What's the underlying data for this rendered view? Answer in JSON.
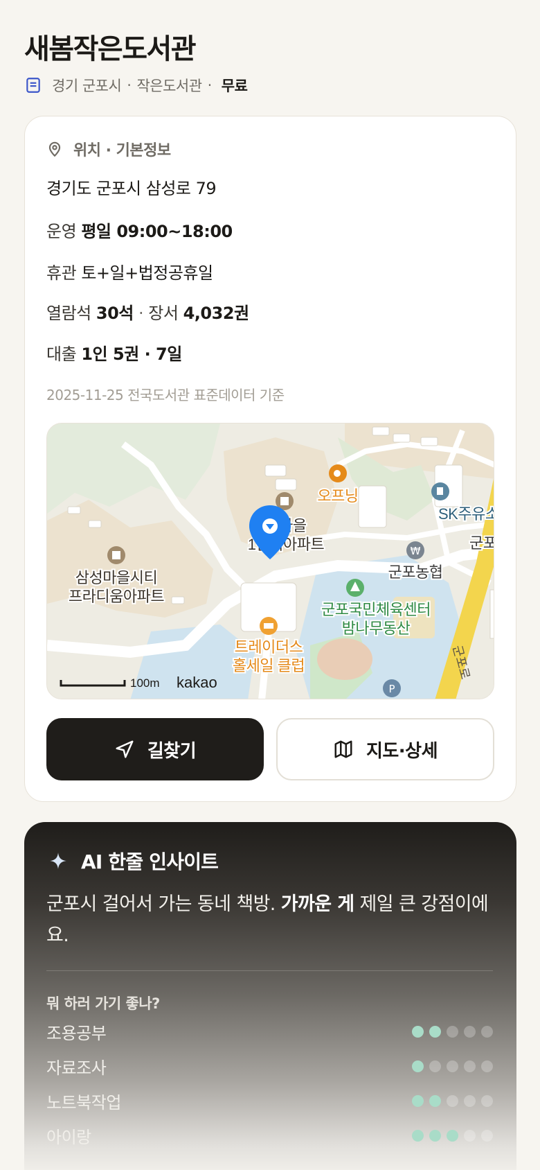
{
  "header": {
    "title": "새봄작은도서관",
    "region": "경기 군포시",
    "category": "작은도서관",
    "fee": "무료",
    "separator": "·"
  },
  "info": {
    "section_title": "위치 · 기본정보",
    "address": "경기도 군포시 삼성로 79",
    "hours_label": "운영",
    "hours_value": "평일 09:00~18:00",
    "closed_label": "휴관",
    "closed_value": "토+일+법정공휴일",
    "seats_label": "열람석",
    "seats_value": "30석",
    "middot": "·",
    "books_label": "장서",
    "books_value": "4,032권",
    "loan_label": "대출",
    "loan_value": "1인 5권 · 7일",
    "source": "2025-11-25 전국도서관 표준데이터 기준"
  },
  "map": {
    "labels": {
      "apt1_line1": "삼성마을시티",
      "apt1_line2": "프라디움아파트",
      "apt2_line1": "성마을",
      "apt2_line2": "1단지아파트",
      "cafe": "오프닝",
      "gas": "SK주유소",
      "bank": "군포농협",
      "center_line1": "군포국민체육센터",
      "center_line2": "밤나무동산",
      "mart_line1": "트레이더스",
      "mart_line2": "홀세일 클럽",
      "road": "군포로",
      "station_partial": "군포",
      "scale": "100m",
      "brand": "kakao"
    },
    "colors": {
      "pin": "#1f80f2",
      "poi_orange": "#e58a1a",
      "poi_green": "#2f9a4a",
      "road_yellow": "#f3d54d",
      "water": "#cfe3ef"
    }
  },
  "actions": {
    "directions": "길찾기",
    "map_detail": "지도·상세"
  },
  "ai": {
    "title": "AI 한줄 인사이트",
    "text_part1": "군포시 걸어서 가는 동네 책방. ",
    "text_bold": "가까운 게",
    "text_part2": " 제일 큰 강점이에요.",
    "question": "뭐 하러 가기 좋나?",
    "activities": [
      {
        "label": "조용공부",
        "rating": 2
      },
      {
        "label": "자료조사",
        "rating": 1
      },
      {
        "label": "노트북작업",
        "rating": 2
      },
      {
        "label": "아이랑",
        "rating": 3
      }
    ],
    "accent": "#a9dcc8"
  }
}
